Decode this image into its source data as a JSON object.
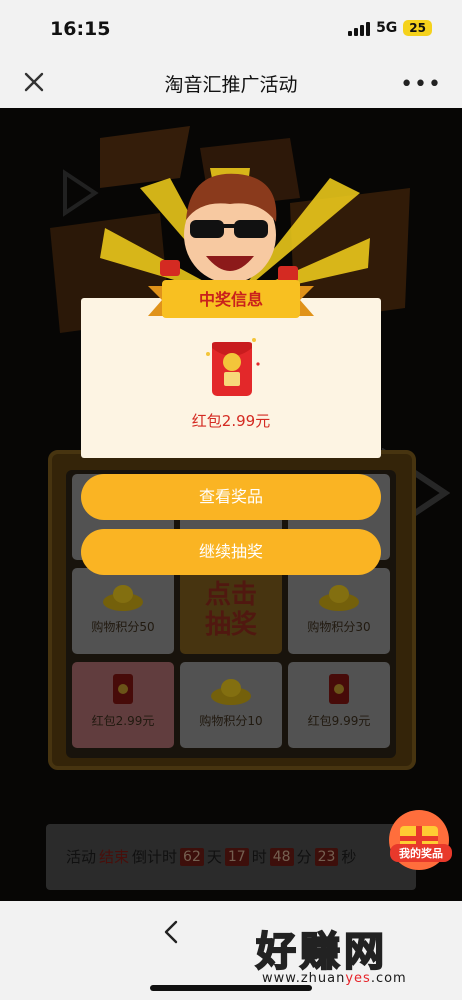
{
  "status_bar": {
    "time": "16:15",
    "network": "5G",
    "battery": "25"
  },
  "nav": {
    "title": "淘音汇推广活动",
    "more": "•••"
  },
  "prize_modal": {
    "ribbon_title": "中奖信息",
    "prize_name": "红包2.99元",
    "view_button": "查看奖品",
    "continue_button": "继续抽奖"
  },
  "lottery_grid": {
    "center_text": [
      "点击",
      "抽奖"
    ],
    "cells": [
      {
        "label": "购物积分50",
        "icon": "gold-ingot-icon"
      },
      {
        "label": "购物积分30",
        "icon": "gold-ingot-icon"
      },
      {
        "label": "红包2.99元",
        "icon": "red-envelope-icon",
        "highlighted": true
      },
      {
        "label": "购物积分10",
        "icon": "gold-ingot-icon"
      },
      {
        "label": "红包9.99元",
        "icon": "red-envelope-icon"
      }
    ]
  },
  "countdown": {
    "prefix": "活动",
    "highlight": "结束",
    "suffix": "倒计时",
    "days": "62",
    "days_unit": "天",
    "hours": "17",
    "hours_unit": "时",
    "minutes": "48",
    "minutes_unit": "分",
    "seconds": "23",
    "seconds_unit": "秒"
  },
  "my_prize": {
    "label": "我的奖品"
  },
  "watermark": {
    "main": "好赚网",
    "sub_pre": "www.zhuan",
    "sub_hl": "yes",
    "sub_post": ".com"
  },
  "colors": {
    "accent": "#fab423",
    "prize_red": "#d42a22",
    "card_bg": "#fdf4e3"
  }
}
